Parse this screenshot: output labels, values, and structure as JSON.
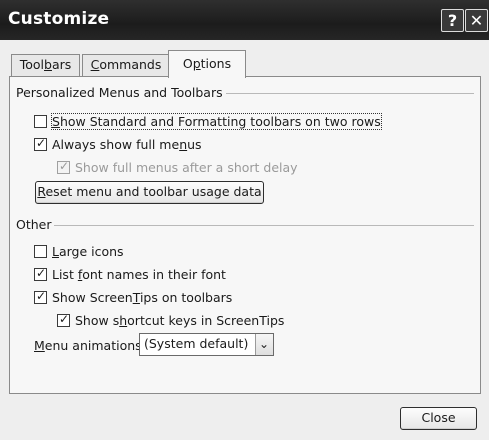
{
  "window": {
    "title": "Customize",
    "help_glyph": "?",
    "close_glyph": "✕"
  },
  "tabs": [
    {
      "label": "Toolbars",
      "active": false
    },
    {
      "label": "Commands",
      "active": false
    },
    {
      "label": "Options",
      "active": true
    }
  ],
  "personalized": {
    "group_label": "Personalized Menus and Toolbars",
    "items": [
      {
        "label": "Show Standard and Formatting toolbars on two rows",
        "checked": false,
        "enabled": true
      },
      {
        "label": "Always show full menus",
        "checked": true,
        "enabled": true
      },
      {
        "label": "Show full menus after a short delay",
        "checked": true,
        "enabled": false
      }
    ],
    "reset_button": "Reset menu and toolbar usage data"
  },
  "other": {
    "group_label": "Other",
    "items": [
      {
        "label": "Large icons",
        "checked": false
      },
      {
        "label": "List font names in their font",
        "checked": true
      },
      {
        "label": "Show ScreenTips on toolbars",
        "checked": true
      },
      {
        "label": "Show shortcut keys in ScreenTips",
        "checked": true
      }
    ],
    "menu_animations_label": "Menu animations:",
    "menu_animations_value": "(System default)"
  },
  "footer": {
    "close_button": "Close"
  },
  "icons": {
    "check": "✓",
    "chevron": "⌄"
  }
}
